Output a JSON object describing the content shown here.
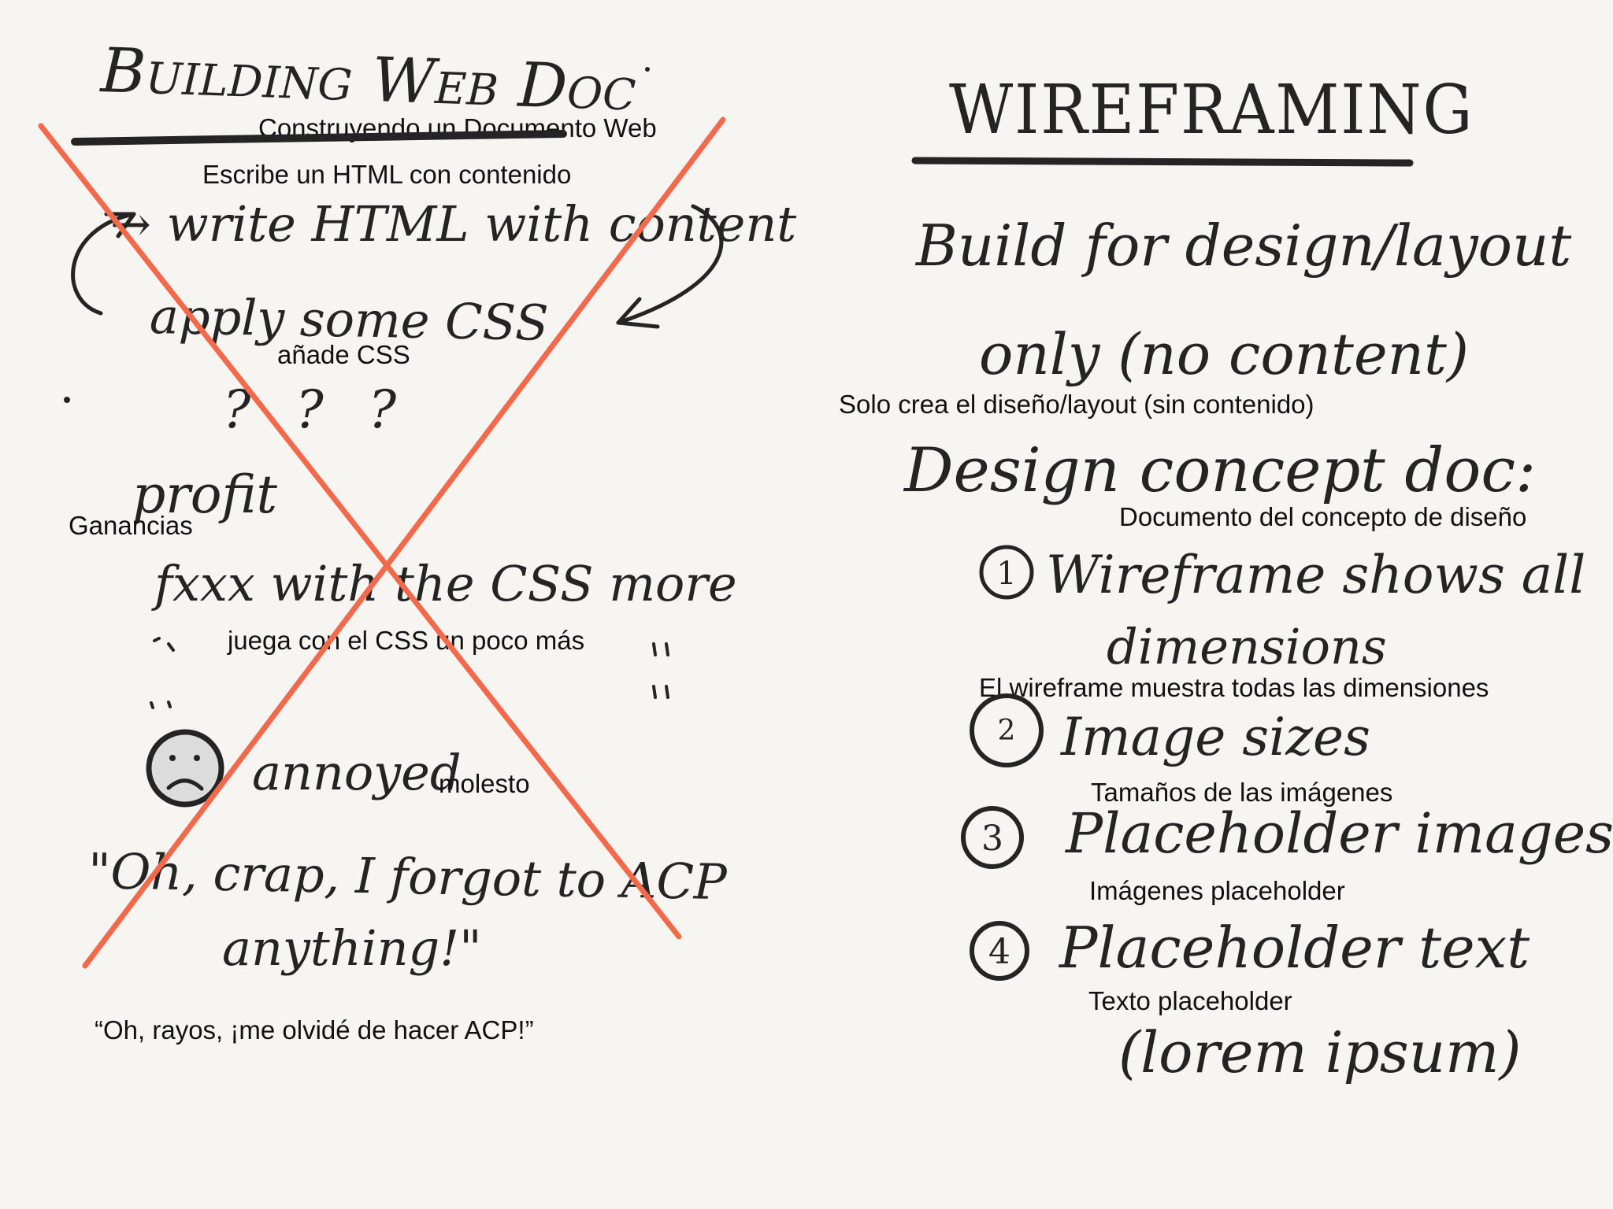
{
  "left_panel": {
    "title": "Building Web Doc",
    "title_translation": "Construyendo un Documento Web",
    "step_write": "→ write HTML with content",
    "step_write_translation": "Escribe un HTML con contenido",
    "step_apply": "apply some CSS",
    "step_apply_translation": "añade CSS",
    "step_questions": "? ? ?",
    "step_profit": "profit",
    "step_profit_translation": "Ganancias",
    "step_fxxx": "fxxx with the CSS more",
    "step_fxxx_translation": "juega con el CSS un poco más",
    "step_annoyed": "annoyed",
    "step_annoyed_translation": "molesto",
    "quote_line1": "\"Oh, crap, I forgot to ACP",
    "quote_line2": "anything!\"",
    "quote_translation": "“Oh, rayos, ¡me olvidé de hacer ACP!”"
  },
  "right_panel": {
    "title": "Wireframing",
    "build_line1": "Build for design/layout",
    "build_line2": "only (no content)",
    "build_translation": "Solo crea el diseño/layout (sin contenido)",
    "concept_heading": "Design concept doc:",
    "concept_translation": "Documento del concepto de diseño",
    "items": [
      {
        "number": "1",
        "line1": "Wireframe shows all",
        "line2": "dimensions",
        "translation": "El wireframe muestra todas las dimensiones"
      },
      {
        "number": "2",
        "line1": "Image sizes",
        "line2": "",
        "translation": "Tamaños de las imágenes"
      },
      {
        "number": "3",
        "line1": "Placeholder images",
        "line2": "",
        "translation": "Imágenes placeholder"
      },
      {
        "number": "4",
        "line1": "Placeholder text",
        "line2": "(lorem ipsum)",
        "translation": "Texto placeholder"
      }
    ]
  },
  "colors": {
    "background": "#f6f5f1",
    "ink": "#242424",
    "cross_out": "#f26a4b",
    "face_fill": "#dcdcdc"
  }
}
